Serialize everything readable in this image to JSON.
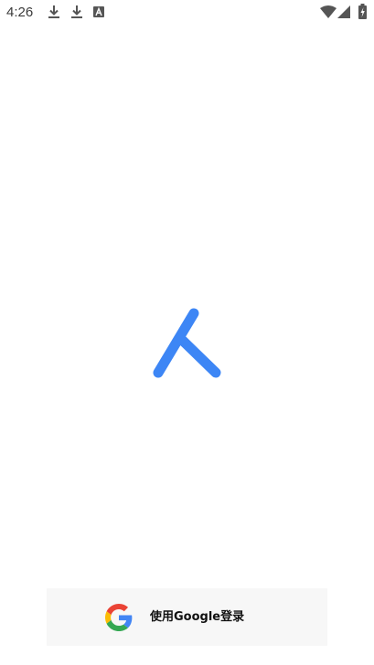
{
  "status_bar": {
    "time": "4:26",
    "icons": [
      "download-icon",
      "download-icon",
      "accessibility-icon",
      "wifi-icon",
      "cellular-signal-icon",
      "battery-charging-icon"
    ]
  },
  "app": {
    "logo": "ren-character-logo-icon",
    "accent_color": "#3d86f5"
  },
  "google_signin": {
    "label": "使用Google登录",
    "icon": "google-icon",
    "background": "#f7f7f7"
  }
}
